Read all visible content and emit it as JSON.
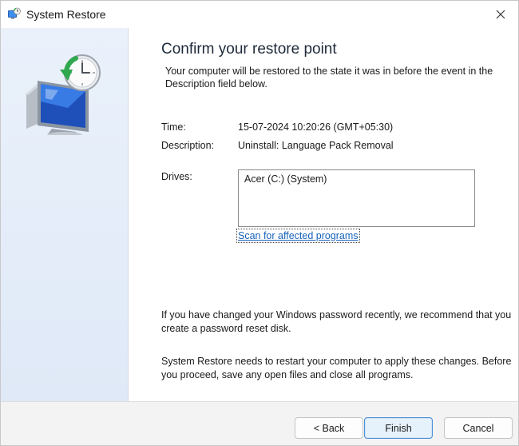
{
  "window": {
    "title": "System Restore",
    "close_label": "✕"
  },
  "main": {
    "heading": "Confirm your restore point",
    "intro": "Your computer will be restored to the state it was in before the event in the Description field below.",
    "time_label": "Time:",
    "time_value": "15-07-2024 10:20:26 (GMT+05:30)",
    "description_label": "Description:",
    "description_value": "Uninstall: Language Pack Removal",
    "drives_label": "Drives:",
    "drives": [
      "Acer (C:) (System)"
    ],
    "scan_link": "Scan for affected programs",
    "password_note": "If you have changed your Windows password recently, we recommend that you create a password reset disk.",
    "restart_note": "System Restore needs to restart your computer to apply these changes. Before you proceed, save any open files and close all programs."
  },
  "footer": {
    "back_label": "< Back",
    "finish_label": "Finish",
    "cancel_label": "Cancel"
  },
  "icons": {
    "app": "system-restore-icon",
    "hero": "system-restore-monitor-clock-icon",
    "close": "close-icon"
  },
  "colors": {
    "accent": "#1862b8",
    "side_panel": "#e4edf9",
    "footer": "#f3f3f3",
    "primary_button_border": "#4a90d9"
  }
}
